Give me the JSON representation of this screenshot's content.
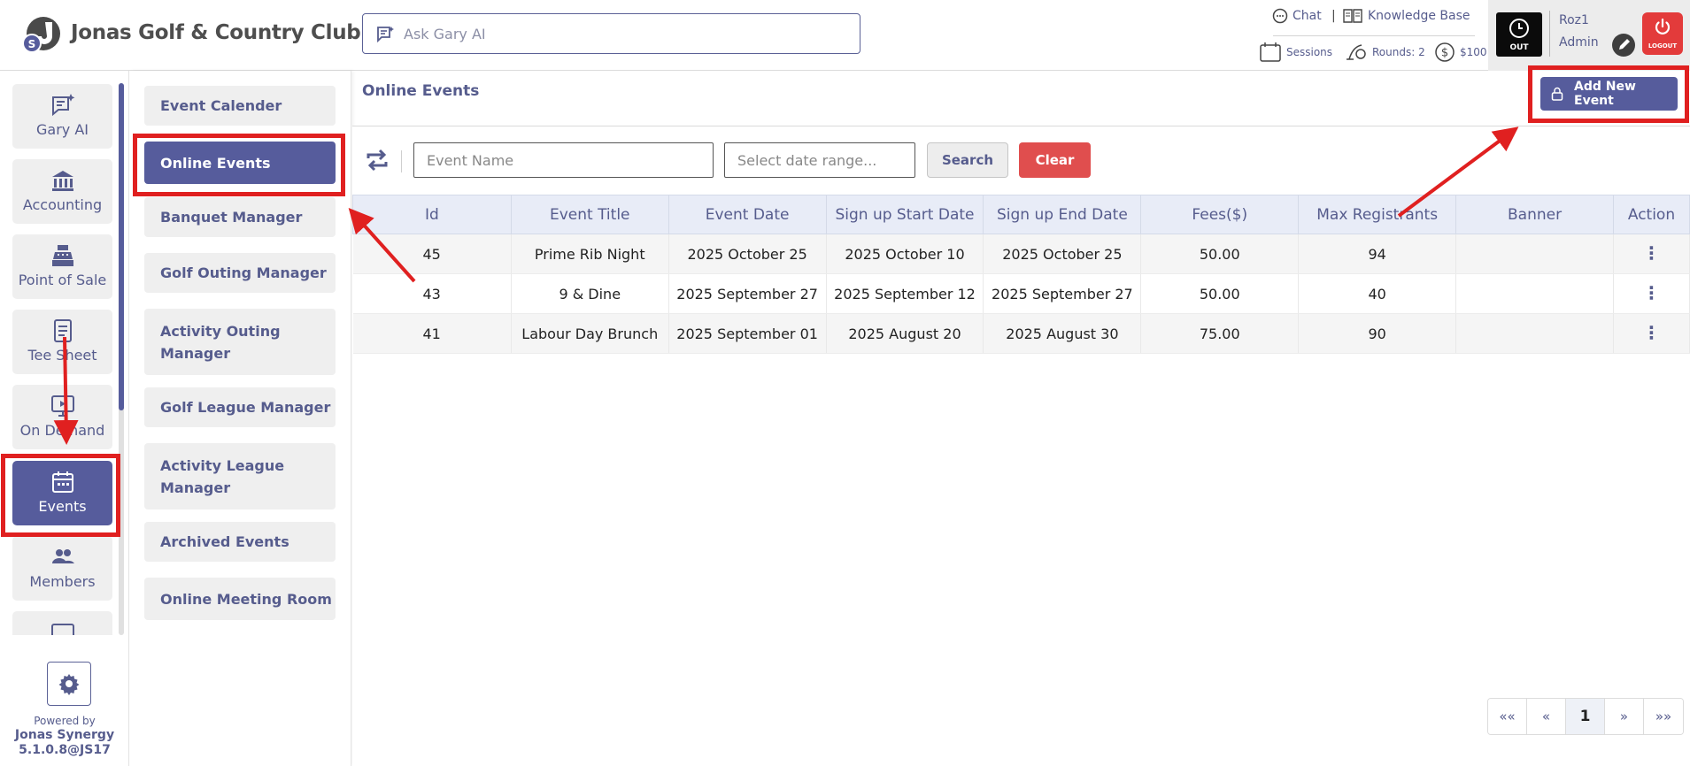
{
  "header": {
    "brand": "Jonas Golf & Country Club",
    "ask_placeholder": "Ask Gary AI",
    "chat": "Chat",
    "knowledge_base": "Knowledge Base",
    "sessions": "Sessions",
    "rounds": "Rounds: 2",
    "balance": "$100",
    "clock_label": "OUT",
    "user_name": "Roz1",
    "user_role": "Admin",
    "logout": "LOGOUT"
  },
  "sidebar": {
    "items": [
      {
        "label": "Gary AI",
        "icon": "gary-ai-icon"
      },
      {
        "label": "Accounting",
        "icon": "bank-icon"
      },
      {
        "label": "Point of Sale",
        "icon": "register-icon"
      },
      {
        "label": "Tee Sheet",
        "icon": "sheet-icon"
      },
      {
        "label": "On Demand",
        "icon": "monitor-icon"
      },
      {
        "label": "Events",
        "icon": "calendar-icon",
        "active": true
      },
      {
        "label": "Members",
        "icon": "members-icon"
      }
    ],
    "powered_by": "Powered by",
    "vendor": "Jonas Synergy",
    "version": "5.1.0.8@JS17"
  },
  "submenu": {
    "items": [
      {
        "label": "Event Calender"
      },
      {
        "label": "Online Events",
        "active": true
      },
      {
        "label": "Banquet Manager"
      },
      {
        "label": "Golf Outing Manager"
      },
      {
        "label": "Activity Outing Manager"
      },
      {
        "label": "Golf League Manager"
      },
      {
        "label": "Activity League Manager"
      },
      {
        "label": "Archived Events"
      },
      {
        "label": "Online Meeting Room"
      }
    ]
  },
  "main": {
    "title": "Online Events",
    "add_button": "Add New Event",
    "filters": {
      "event_name_placeholder": "Event Name",
      "date_range_placeholder": "Select date range...",
      "search": "Search",
      "clear": "Clear"
    },
    "table": {
      "columns": [
        "Id",
        "Event Title",
        "Event Date",
        "Sign up Start Date",
        "Sign up End Date",
        "Fees($)",
        "Max Registrants",
        "Banner",
        "Action"
      ],
      "rows": [
        {
          "id": "45",
          "title": "Prime Rib Night",
          "date": "2025 October 25",
          "start": "2025 October 10",
          "end": "2025 October 25",
          "fees": "50.00",
          "max": "94",
          "banner": ""
        },
        {
          "id": "43",
          "title": "9 & Dine",
          "date": "2025 September 27",
          "start": "2025 September 12",
          "end": "2025 September 27",
          "fees": "50.00",
          "max": "40",
          "banner": ""
        },
        {
          "id": "41",
          "title": "Labour Day Brunch",
          "date": "2025 September 01",
          "start": "2025 August 20",
          "end": "2025 August 30",
          "fees": "75.00",
          "max": "90",
          "banner": ""
        }
      ]
    },
    "pagination": {
      "first": "««",
      "prev": "«",
      "current": "1",
      "next": "»",
      "last": "»»"
    }
  },
  "colors": {
    "brand": "#565c9c",
    "danger": "#e04e4e",
    "annotation": "#e02020"
  }
}
